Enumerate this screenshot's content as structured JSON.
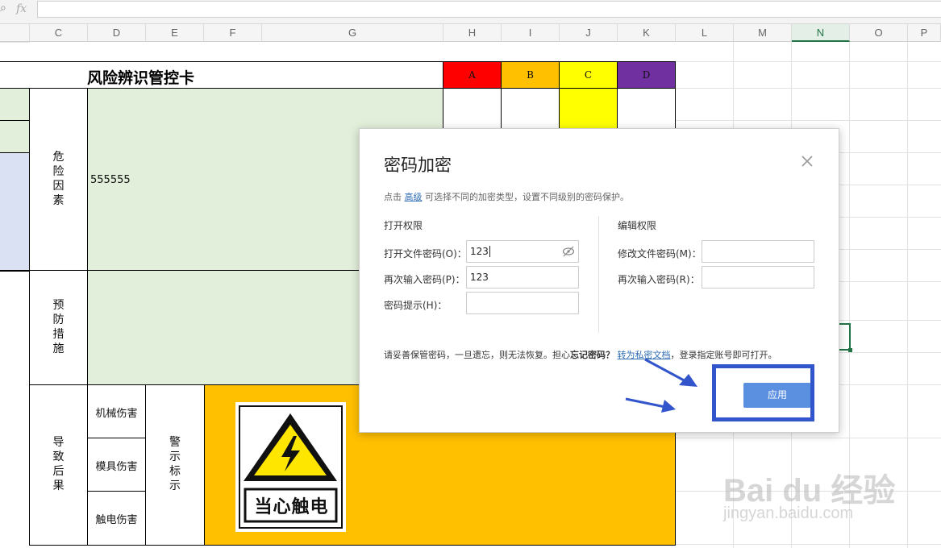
{
  "formula_bar": {
    "fx_label": "fx",
    "value": ""
  },
  "columns": [
    "C",
    "D",
    "E",
    "F",
    "G",
    "H",
    "I",
    "J",
    "K",
    "L",
    "M",
    "N",
    "O",
    "P"
  ],
  "sheet": {
    "title": "风险辨识管控卡",
    "levels": [
      "A",
      "B",
      "C",
      "D"
    ],
    "level_colors": {
      "A": "#ff0000",
      "B": "#ffc000",
      "C": "#ffff00",
      "D": "#7030a0"
    },
    "risk_factor_label": [
      "危",
      "险",
      "因",
      "素"
    ],
    "risk_factor_value": "555555",
    "prevention_label": [
      "预",
      "防",
      "措",
      "施"
    ],
    "consequence_label": [
      "导",
      "致",
      "后",
      "果"
    ],
    "consequences": [
      "机械伤害",
      "模具伤害",
      "触电伤害"
    ],
    "warning_label": [
      "警",
      "示",
      "标",
      "示"
    ],
    "warning_sign_text": "当心触电"
  },
  "dialog": {
    "title": "密码加密",
    "hint_prefix": "点击",
    "hint_link": "高级",
    "hint_suffix": "可选择不同的加密类型，设置不同级别的密码保护。",
    "open_section": "打开权限",
    "open_password_label": "打开文件密码(O)：",
    "open_password_value": "123",
    "reenter_password_label": "再次输入密码(P)：",
    "reenter_password_value": "123",
    "hint_label": "密码提示(H)：",
    "hint_value": "",
    "edit_section": "编辑权限",
    "edit_password_label": "修改文件密码(M)：",
    "edit_password_value": "",
    "edit_reenter_label": "再次输入密码(R)：",
    "edit_reenter_value": "",
    "warning_prefix": "请妥善保管密码，一旦遗忘，则无法恢复。担心",
    "warning_bold": "忘记密码？",
    "warning_link": "转为私密文档",
    "warning_suffix": "，登录指定账号即可打开。",
    "apply_label": "应用"
  },
  "watermark": {
    "brand": "Bai du 经验",
    "url": "jingyan.baidu.com"
  },
  "colors": {
    "accent": "#4a90e2",
    "annotation": "#3355cc",
    "grid_green": "#e2efda",
    "grid_blue": "#d9e1f2",
    "orange": "#ffc000"
  }
}
